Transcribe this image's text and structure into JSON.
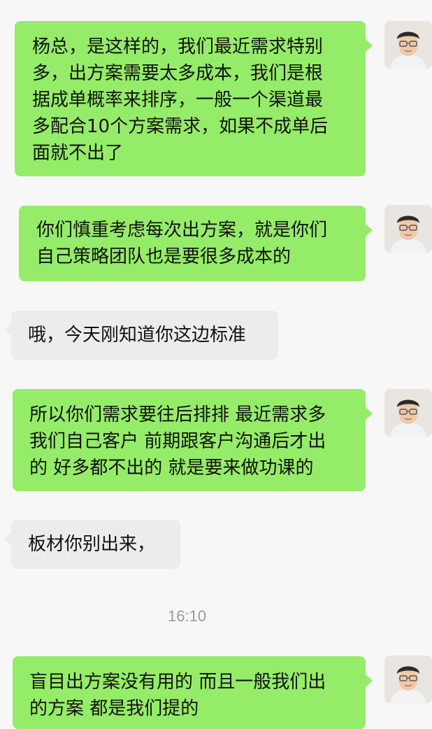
{
  "messages": [
    {
      "side": "me",
      "text": "杨总，是这样的，我们最近需求特别\n多，出方案需要太多成本，我们是根\n据成单概率来排序，一般一个渠道最\n多配合10个方案需求，如果不成单后\n面就不出了"
    },
    {
      "side": "me",
      "text": "你们慎重考虑每次出方案，就是你们\n自己策略团队也是要很多成本的"
    },
    {
      "side": "them",
      "text": "哦，今天刚知道你这边标准"
    },
    {
      "side": "me",
      "text": "所以你们需求要往后排排 最近需求多\n我们自己客户 前期跟客户沟通后才出\n的 好多都不出的 就是要来做功课的"
    },
    {
      "side": "them",
      "text": "板材你别出来，"
    },
    {
      "side": "me",
      "text": "盲目出方案没有用的 而且一般我们出\n的方案 都是我们提的"
    }
  ],
  "timestamp": "16:10",
  "colors": {
    "me_bubble": "#95ec69",
    "them_bubble": "#ececec",
    "background": "#f7f7f7",
    "timestamp": "#9a9a9a"
  },
  "icons": {
    "avatar": "user-avatar-photo-icon"
  }
}
